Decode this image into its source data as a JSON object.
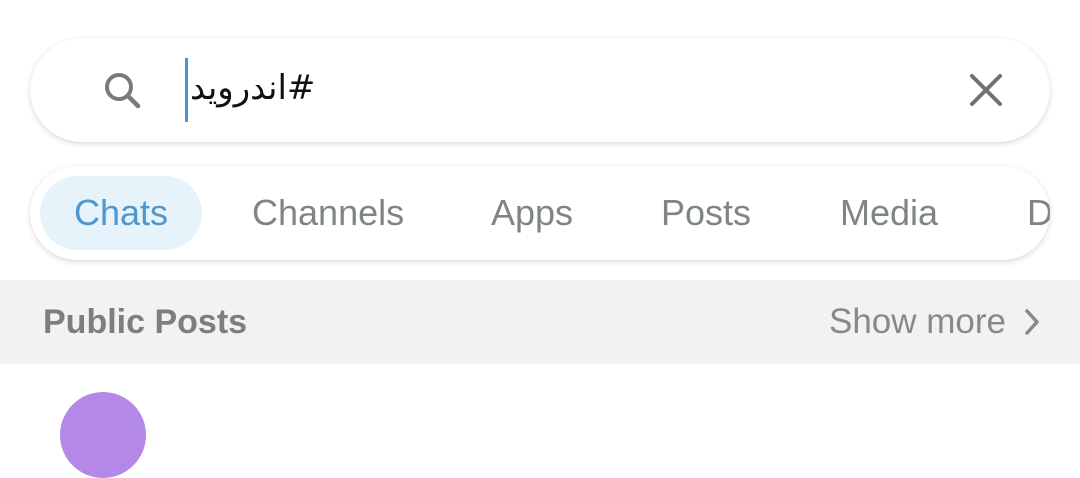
{
  "search": {
    "value": "#اندروید",
    "icon": "search-icon",
    "clear_icon": "close-icon"
  },
  "tabs": [
    {
      "label": "Chats",
      "active": true
    },
    {
      "label": "Channels",
      "active": false
    },
    {
      "label": "Apps",
      "active": false
    },
    {
      "label": "Posts",
      "active": false
    },
    {
      "label": "Media",
      "active": false
    },
    {
      "label": "D",
      "active": false
    }
  ],
  "section": {
    "title": "Public Posts",
    "show_more_label": "Show more",
    "show_more_icon": "chevron-right-icon"
  },
  "colors": {
    "accent": "#4f97cc",
    "accent_bg": "#e7f3fb",
    "caret": "#4a95d1",
    "avatar": "#b388e6"
  }
}
